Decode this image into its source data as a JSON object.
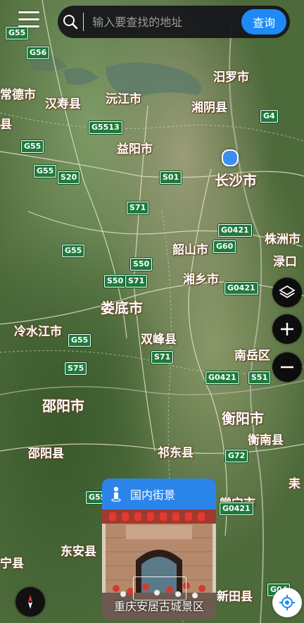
{
  "search": {
    "placeholder": "输入要查找的地址",
    "button_label": "查询"
  },
  "street_view": {
    "title": "国内街景",
    "caption": "重庆安居古城景区"
  },
  "cities": [
    {
      "name": "汨罗市",
      "major": false
    },
    {
      "name": "常德市",
      "major": false
    },
    {
      "name": "汉寿县",
      "major": false
    },
    {
      "name": "沅江市",
      "major": false
    },
    {
      "name": "湘阴县",
      "major": false
    },
    {
      "name": "益阳市",
      "major": false
    },
    {
      "name": "长沙市",
      "major": true
    },
    {
      "name": "株洲市",
      "major": false
    },
    {
      "name": "韶山市",
      "major": false
    },
    {
      "name": "湘乡市",
      "major": false
    },
    {
      "name": "娄底市",
      "major": true
    },
    {
      "name": "冷水江市",
      "major": false
    },
    {
      "name": "双峰县",
      "major": false
    },
    {
      "name": "南岳区",
      "major": false
    },
    {
      "name": "邵阳市",
      "major": true
    },
    {
      "name": "衡阳市",
      "major": true
    },
    {
      "name": "衡南县",
      "major": false
    },
    {
      "name": "邵阳县",
      "major": false
    },
    {
      "name": "祁东县",
      "major": false
    },
    {
      "name": "东安县",
      "major": false
    },
    {
      "name": "常宁市",
      "major": false
    },
    {
      "name": "新田县",
      "major": false
    },
    {
      "name": "宁县",
      "major": false
    },
    {
      "name": "县",
      "major": false
    },
    {
      "name": "渌口",
      "major": false
    },
    {
      "name": "耒",
      "major": false
    }
  ],
  "road_shields": [
    {
      "label": "G55",
      "color": "green"
    },
    {
      "label": "G56",
      "color": "green"
    },
    {
      "label": "G5513",
      "color": "green"
    },
    {
      "label": "G55",
      "color": "green"
    },
    {
      "label": "G55",
      "color": "green"
    },
    {
      "label": "S20",
      "color": "green"
    },
    {
      "label": "S01",
      "color": "green"
    },
    {
      "label": "S71",
      "color": "green"
    },
    {
      "label": "G4",
      "color": "green"
    },
    {
      "label": "G0421",
      "color": "green"
    },
    {
      "label": "G60",
      "color": "green"
    },
    {
      "label": "G55",
      "color": "green"
    },
    {
      "label": "S50",
      "color": "green"
    },
    {
      "label": "S50",
      "color": "green"
    },
    {
      "label": "S71",
      "color": "green"
    },
    {
      "label": "G0421",
      "color": "green"
    },
    {
      "label": "G55",
      "color": "green"
    },
    {
      "label": "S75",
      "color": "green"
    },
    {
      "label": "S71",
      "color": "green"
    },
    {
      "label": "G0421",
      "color": "green"
    },
    {
      "label": "S51",
      "color": "green"
    },
    {
      "label": "G72",
      "color": "green"
    },
    {
      "label": "G55",
      "color": "green"
    },
    {
      "label": "G04",
      "color": "green"
    },
    {
      "label": "G0421",
      "color": "green"
    }
  ]
}
